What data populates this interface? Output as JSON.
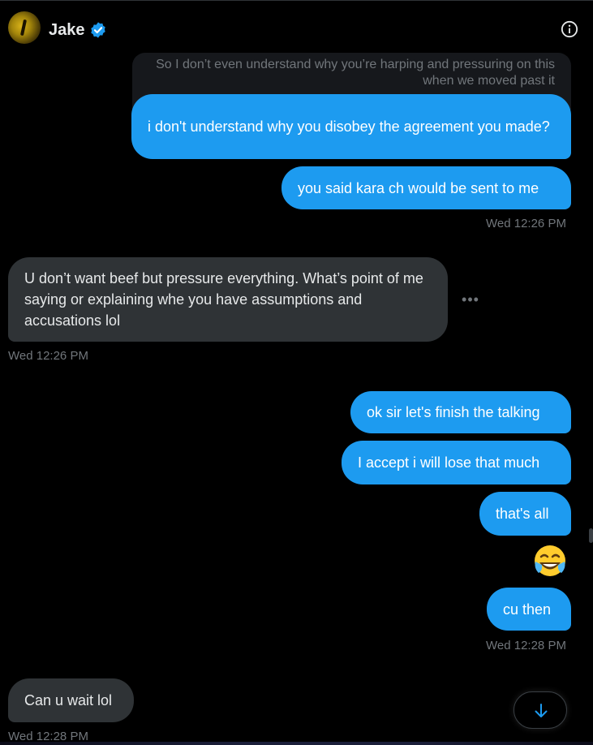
{
  "header": {
    "name": "Jake",
    "avatar_icon": "avatar",
    "verified_icon": "verified-badge-icon",
    "info_icon": "info-icon",
    "accent_color": "#1d9bf0"
  },
  "quoted": {
    "text": "So I don’t even understand why you’re harping and pressuring on this when we moved past it"
  },
  "messages": [
    {
      "from": "me",
      "text": "i don't understand why you disobey the agreement you made?"
    },
    {
      "from": "me",
      "text": "you said kara ch would be sent to me"
    },
    {
      "from": "them",
      "text": "U don’t want beef but pressure everything. What’s point of me saying or explaining whe you have assumptions and accusations lol"
    },
    {
      "from": "me",
      "text": "ok sir let's finish the talking"
    },
    {
      "from": "me",
      "text": "I accept i will lose that much"
    },
    {
      "from": "me",
      "text": "that's all"
    },
    {
      "from": "me",
      "text": "😂",
      "emoji": "face-with-tears-of-joy-icon"
    },
    {
      "from": "me",
      "text": "cu then"
    },
    {
      "from": "them",
      "text": "Can u wait lol"
    }
  ],
  "timestamps": {
    "t1": "Wed 12:26 PM",
    "t2": "Wed 12:26 PM",
    "t3": "Wed 12:28 PM",
    "t4": "Wed 12:28 PM"
  },
  "controls": {
    "more_dots": "•••",
    "scroll_down_icon": "arrow-down-icon"
  },
  "colors": {
    "outgoing_bubble": "#1d9bf0",
    "incoming_bubble": "#2f3336",
    "background": "#000000",
    "muted_text": "#71767b"
  }
}
